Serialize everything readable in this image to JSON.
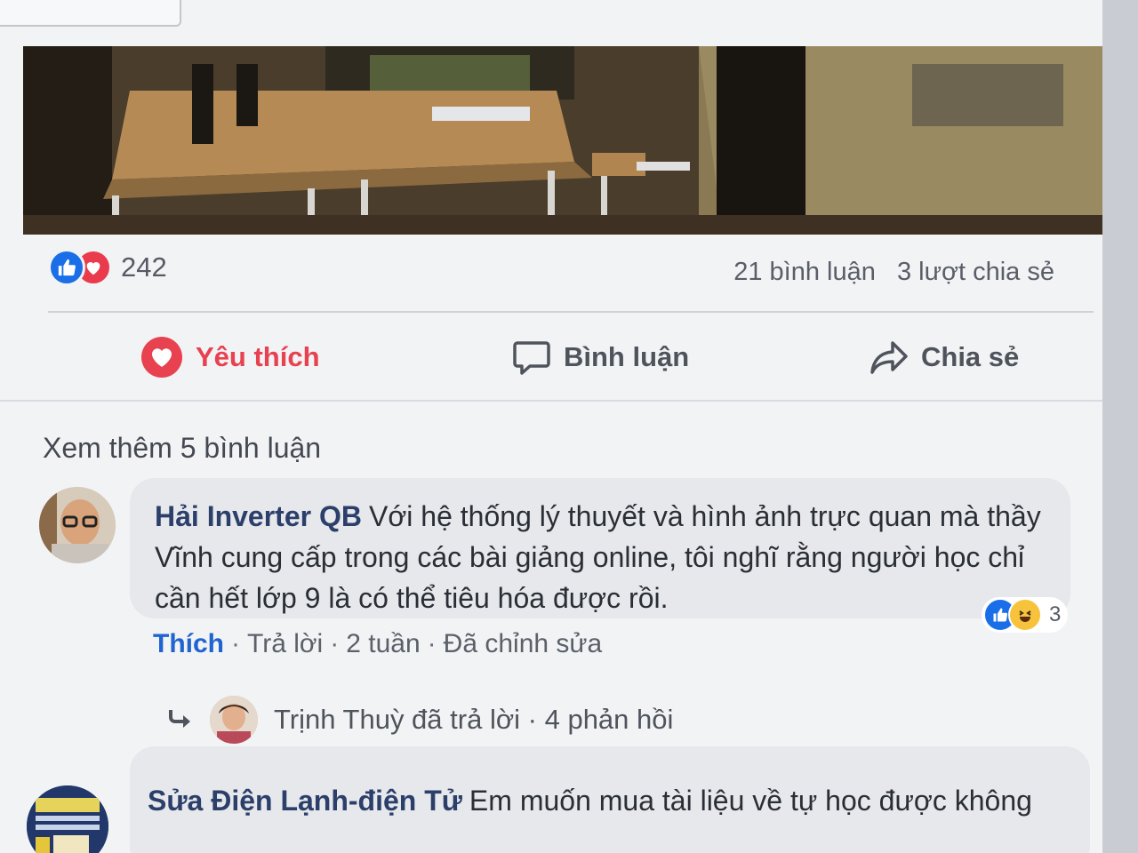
{
  "post": {
    "reactions": {
      "count": "242",
      "icons": [
        "like-icon",
        "love-icon"
      ]
    },
    "stats": {
      "comments": "21 bình luận",
      "shares": "3 lượt chia sẻ"
    },
    "actions": {
      "like": "Yêu thích",
      "comment": "Bình luận",
      "share": "Chia sẻ"
    }
  },
  "comments_section": {
    "view_more": "Xem thêm 5 bình luận",
    "comments": [
      {
        "author": "Hải Inverter QB",
        "text": "Với hệ thống lý thuyết và hình ảnh trực quan mà thầy Vĩnh cung cấp trong các bài giảng online, tôi nghĩ rằng người học chỉ cần hết lớp 9 là có thể tiêu hóa được rồi.",
        "reaction_count": "3",
        "reaction_icons": [
          "like-icon",
          "haha-icon"
        ],
        "meta": {
          "like": "Thích",
          "reply": "Trả lời",
          "time": "2 tuần",
          "edited": "Đã chỉnh sửa"
        },
        "reply_summary": "Trịnh Thuỳ đã trả lời · 4 phản hồi"
      },
      {
        "author": "Sửa Điện Lạnh-điện Tử",
        "text": "Em muốn mua tài liệu về tự học được không"
      }
    ]
  },
  "colors": {
    "like_blue": "#1a6fe8",
    "love_red": "#e8414f",
    "author_navy": "#2c3f6b",
    "bubble_gray": "#e6e8eb"
  }
}
